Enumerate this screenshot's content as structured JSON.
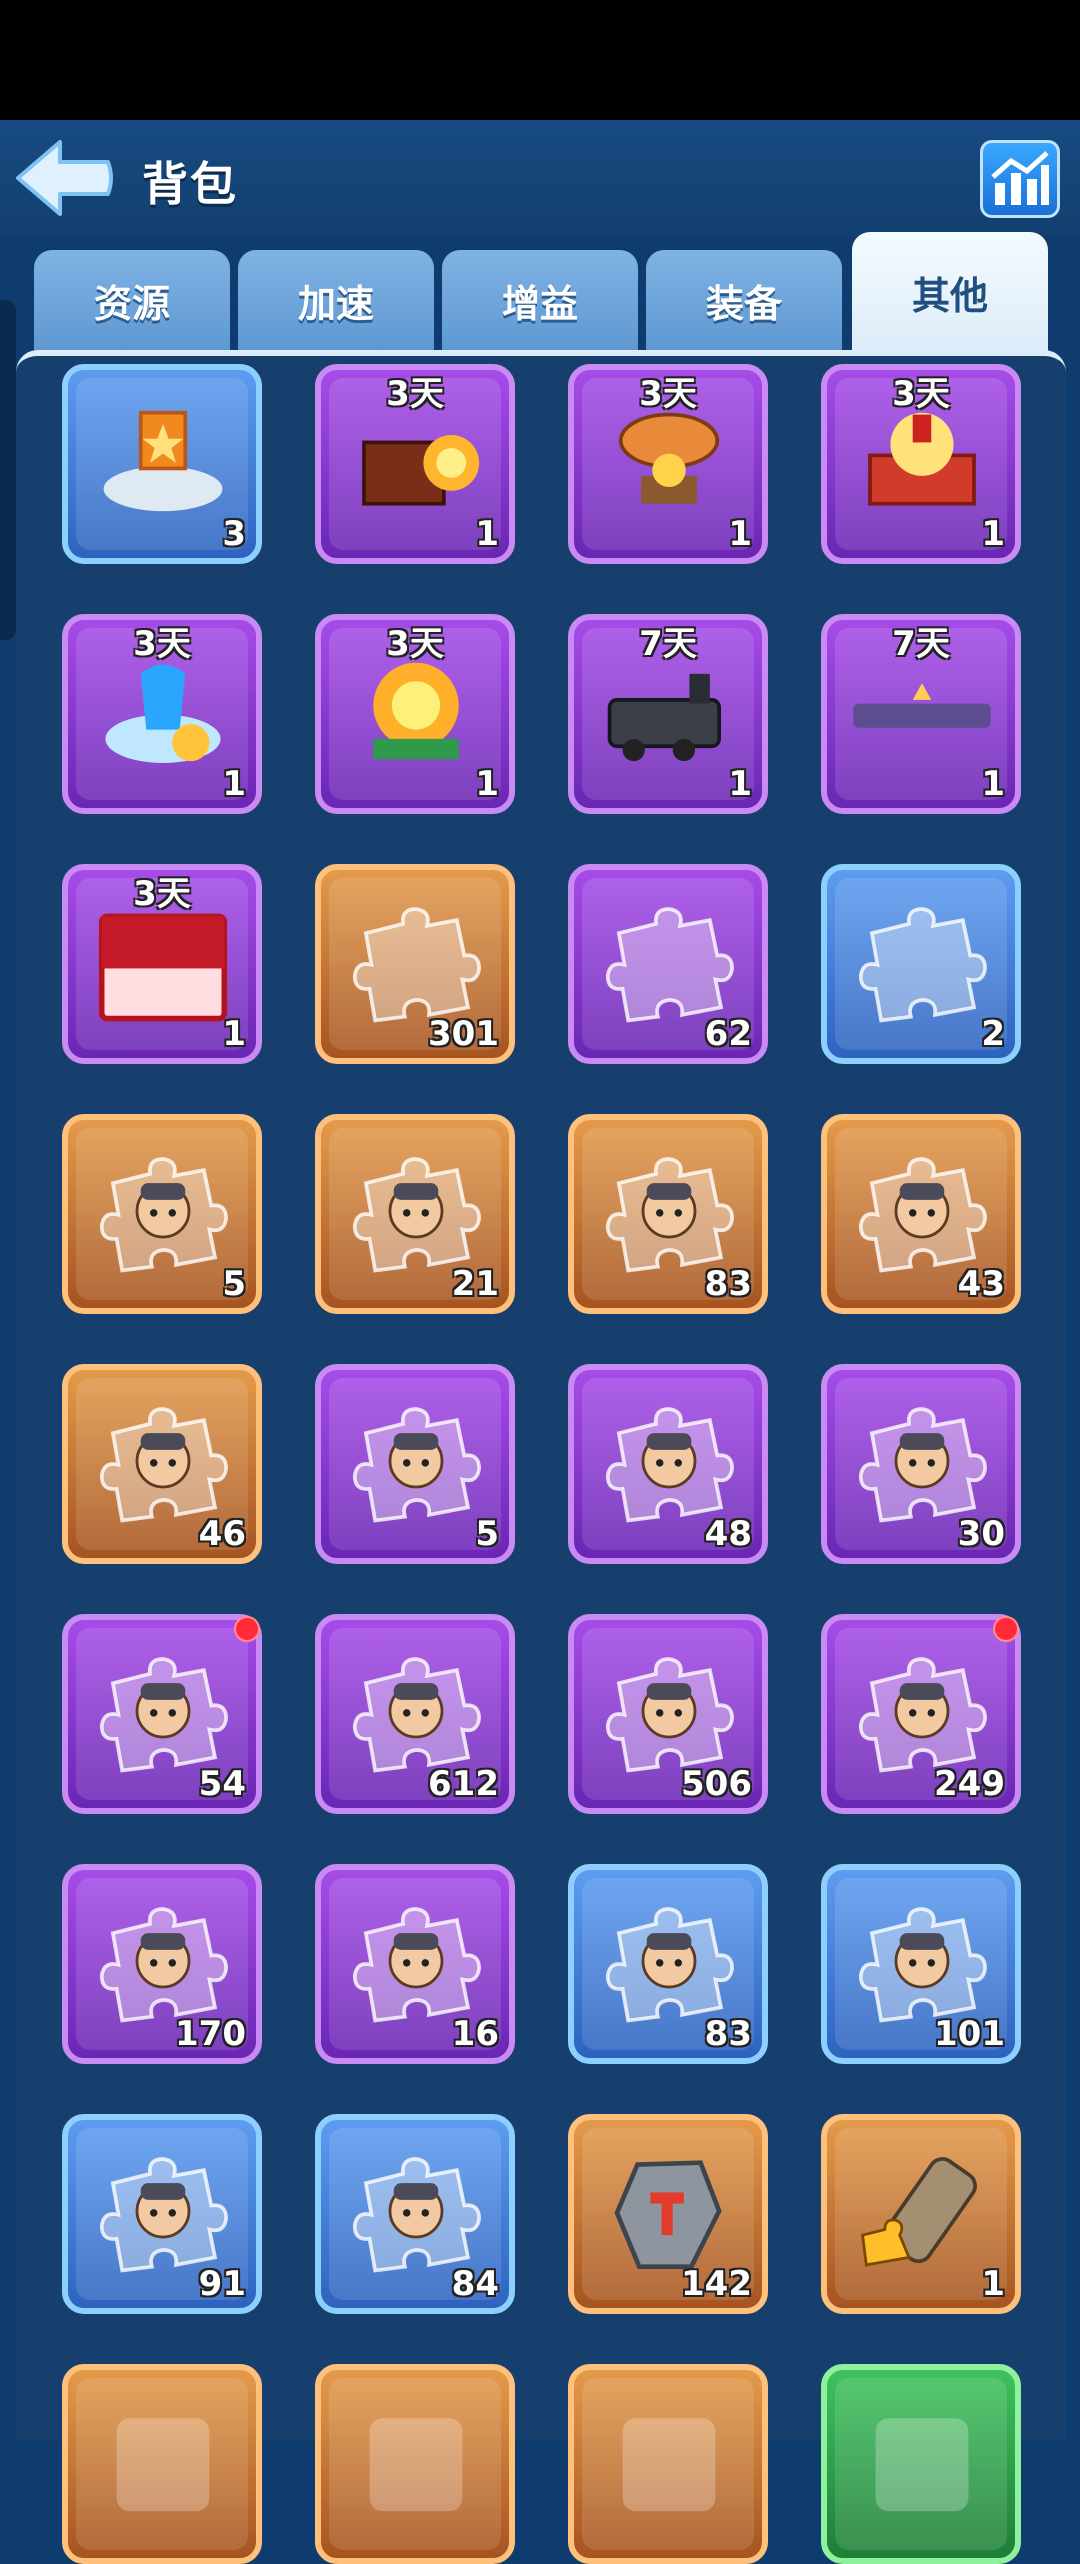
{
  "header": {
    "title": "背包"
  },
  "tabs": [
    {
      "label": "资源",
      "active": false
    },
    {
      "label": "加速",
      "active": false
    },
    {
      "label": "增益",
      "active": false
    },
    {
      "label": "装备",
      "active": false
    },
    {
      "label": "其他",
      "active": true
    }
  ],
  "items": [
    {
      "icon": "emblem-plaza-icon",
      "rarity": "blue",
      "timer": "",
      "count": "3",
      "alert": false
    },
    {
      "icon": "fire-furnace-decoration-icon",
      "rarity": "purple",
      "timer": "3天",
      "count": "1",
      "alert": false
    },
    {
      "icon": "airship-decoration-icon",
      "rarity": "purple",
      "timer": "3天",
      "count": "1",
      "alert": false
    },
    {
      "icon": "festive-gift-decoration-icon",
      "rarity": "purple",
      "timer": "3天",
      "count": "1",
      "alert": false
    },
    {
      "icon": "ice-dragon-decoration-icon",
      "rarity": "purple",
      "timer": "3天",
      "count": "1",
      "alert": false
    },
    {
      "icon": "fire-dragon-decoration-icon",
      "rarity": "purple",
      "timer": "3天",
      "count": "1",
      "alert": false
    },
    {
      "icon": "locomotive-icon",
      "rarity": "purple",
      "timer": "7天",
      "count": "1",
      "alert": false
    },
    {
      "icon": "nameplate-icon",
      "rarity": "purple",
      "timer": "7天",
      "count": "1",
      "alert": false
    },
    {
      "icon": "red-banner-frame-icon",
      "rarity": "purple",
      "timer": "3天",
      "count": "1",
      "alert": false
    },
    {
      "icon": "puzzle-piece-icon",
      "rarity": "orange",
      "timer": "",
      "count": "301",
      "alert": false
    },
    {
      "icon": "puzzle-piece-icon",
      "rarity": "purple",
      "timer": "",
      "count": "62",
      "alert": false
    },
    {
      "icon": "puzzle-piece-icon",
      "rarity": "blue",
      "timer": "",
      "count": "2",
      "alert": false
    },
    {
      "icon": "hero-puzzle-icon",
      "rarity": "orange",
      "timer": "",
      "count": "5",
      "alert": false
    },
    {
      "icon": "hero-puzzle-icon",
      "rarity": "orange",
      "timer": "",
      "count": "21",
      "alert": false
    },
    {
      "icon": "hero-puzzle-icon",
      "rarity": "orange",
      "timer": "",
      "count": "83",
      "alert": false
    },
    {
      "icon": "hero-puzzle-icon",
      "rarity": "orange",
      "timer": "",
      "count": "43",
      "alert": false
    },
    {
      "icon": "hero-puzzle-icon",
      "rarity": "orange",
      "timer": "",
      "count": "46",
      "alert": false
    },
    {
      "icon": "hero-puzzle-icon",
      "rarity": "purple",
      "timer": "",
      "count": "5",
      "alert": false
    },
    {
      "icon": "hero-puzzle-icon",
      "rarity": "purple",
      "timer": "",
      "count": "48",
      "alert": false
    },
    {
      "icon": "hero-puzzle-icon",
      "rarity": "purple",
      "timer": "",
      "count": "30",
      "alert": false
    },
    {
      "icon": "hero-puzzle-icon",
      "rarity": "purple",
      "timer": "",
      "count": "54",
      "alert": true
    },
    {
      "icon": "hero-puzzle-icon",
      "rarity": "purple",
      "timer": "",
      "count": "612",
      "alert": false
    },
    {
      "icon": "hero-puzzle-icon",
      "rarity": "purple",
      "timer": "",
      "count": "506",
      "alert": false
    },
    {
      "icon": "hero-puzzle-icon",
      "rarity": "purple",
      "timer": "",
      "count": "249",
      "alert": true
    },
    {
      "icon": "hero-puzzle-icon",
      "rarity": "purple",
      "timer": "",
      "count": "170",
      "alert": false
    },
    {
      "icon": "hero-puzzle-icon",
      "rarity": "purple",
      "timer": "",
      "count": "16",
      "alert": false
    },
    {
      "icon": "hero-puzzle-icon",
      "rarity": "blue",
      "timer": "",
      "count": "83",
      "alert": false
    },
    {
      "icon": "hero-puzzle-icon",
      "rarity": "blue",
      "timer": "",
      "count": "101",
      "alert": false
    },
    {
      "icon": "hero-puzzle-icon",
      "rarity": "blue",
      "timer": "",
      "count": "91",
      "alert": false
    },
    {
      "icon": "hero-puzzle-icon",
      "rarity": "blue",
      "timer": "",
      "count": "84",
      "alert": false
    },
    {
      "icon": "whetstone-icon",
      "rarity": "orange",
      "timer": "",
      "count": "142",
      "alert": false
    },
    {
      "icon": "puzzle-cannon-icon",
      "rarity": "orange",
      "timer": "",
      "count": "1",
      "alert": false
    },
    {
      "icon": "item-icon",
      "rarity": "orange",
      "timer": "",
      "count": "",
      "alert": false
    },
    {
      "icon": "item-icon",
      "rarity": "orange",
      "timer": "",
      "count": "",
      "alert": false
    },
    {
      "icon": "item-icon",
      "rarity": "orange",
      "timer": "",
      "count": "",
      "alert": false
    },
    {
      "icon": "item-icon",
      "rarity": "green",
      "timer": "",
      "count": "",
      "alert": false
    }
  ]
}
